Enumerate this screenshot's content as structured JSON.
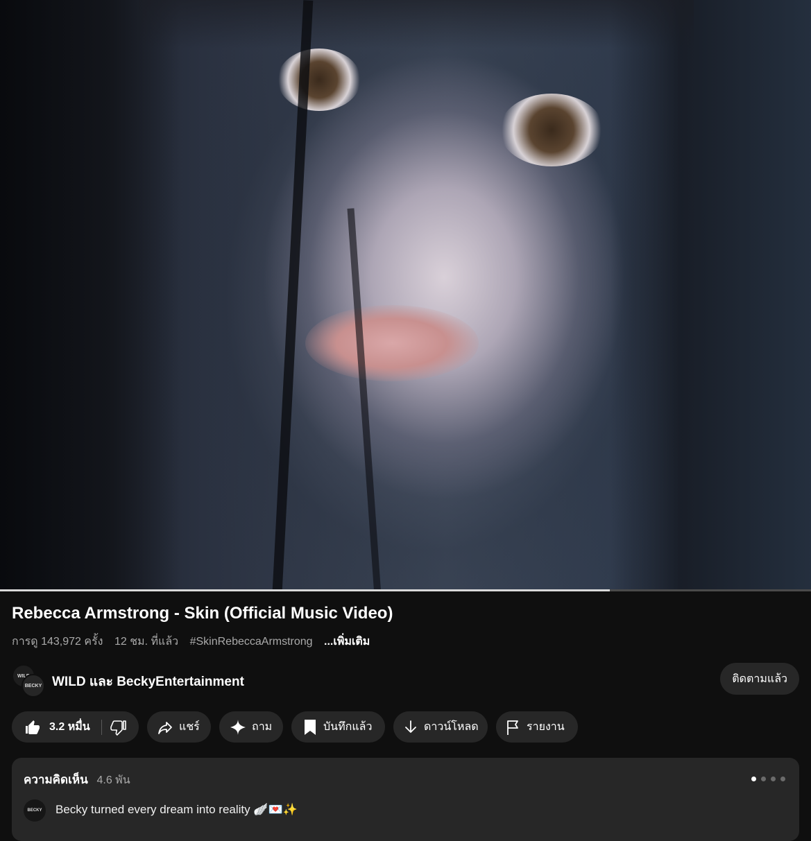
{
  "player": {
    "progress_fraction": 0.752
  },
  "video": {
    "title": "Rebecca Armstrong - Skin (Official Music Video)",
    "views": "การดู 143,972 ครั้ง",
    "uploaded": "12 ชม. ที่แล้ว",
    "hashtag": "#SkinRebeccaArmstrong",
    "more": "...เพิ่มเติม"
  },
  "channel": {
    "name": "WILD และ BeckyEntertainment",
    "avatar1_text": "WILD",
    "avatar2_text": "BECKY",
    "subscribe_label": "ติดตามแล้ว"
  },
  "actions": {
    "like_count": "3.2 หมื่น",
    "share_label": "แชร์",
    "ask_label": "ถาม",
    "save_label": "บันทึกแล้ว",
    "download_label": "ดาวน์โหลด",
    "report_label": "รายงาน"
  },
  "comments": {
    "title": "ความคิดเห็น",
    "count": "4.6 พัน",
    "avatar_text": "BECKY",
    "top_comment": "Becky turned every dream into reality 🪽💌✨",
    "page_dots": 4,
    "active_dot": 0
  },
  "icons": {
    "like": "thumbs-up-icon",
    "dislike": "thumbs-down-icon",
    "share": "share-arrow-icon",
    "ask": "sparkle-icon",
    "save": "bookmark-icon",
    "download": "download-arrow-icon",
    "report": "flag-icon"
  }
}
